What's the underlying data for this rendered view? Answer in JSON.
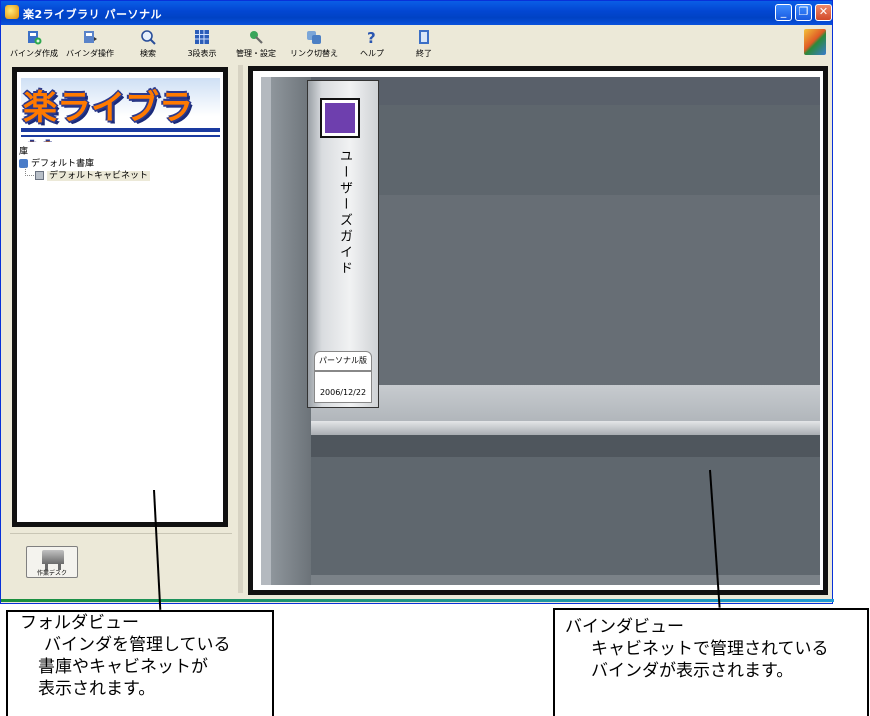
{
  "window": {
    "title": "楽2ライブラリ パーソナル",
    "controls": {
      "minimize": "_",
      "restore": "❐",
      "close": "✕"
    }
  },
  "toolbar": {
    "items": [
      {
        "label": "バインダ作成",
        "icon": "binder-create-icon"
      },
      {
        "label": "バインダ操作",
        "icon": "binder-operation-icon"
      },
      {
        "label": "検索",
        "icon": "search-icon"
      },
      {
        "label": "3段表示",
        "icon": "three-tier-view-icon"
      },
      {
        "label": "管理・設定",
        "icon": "settings-icon"
      },
      {
        "label": "リンク切替え",
        "icon": "link-switch-icon"
      },
      {
        "label": "ヘルプ",
        "icon": "help-icon"
      },
      {
        "label": "終了",
        "icon": "exit-icon"
      }
    ]
  },
  "folder_view": {
    "banner_title": "楽ライブラリ",
    "tree": {
      "root": "庫",
      "library": "デフォルト書庫",
      "cabinet": "デフォルトキャビネット"
    }
  },
  "work_desk": {
    "label": "作業デスク"
  },
  "binder": {
    "title": "ユーザーズガイド",
    "edition": "パーソナル版",
    "date": "2006/12/22",
    "label_color": "#6e3fae"
  },
  "callouts": {
    "folder": {
      "title": "フォルダビュー",
      "line1": "バインダを管理している",
      "line2": "書庫やキャビネットが",
      "line3": "表示されます。"
    },
    "binder": {
      "title": "バインダビュー",
      "line1": "キャビネットで管理されている",
      "line2": "バインダが表示されます。"
    }
  },
  "colors": {
    "titlebar": "#0347d3",
    "highlight_border": "#111111",
    "shelf": "#60686f"
  }
}
